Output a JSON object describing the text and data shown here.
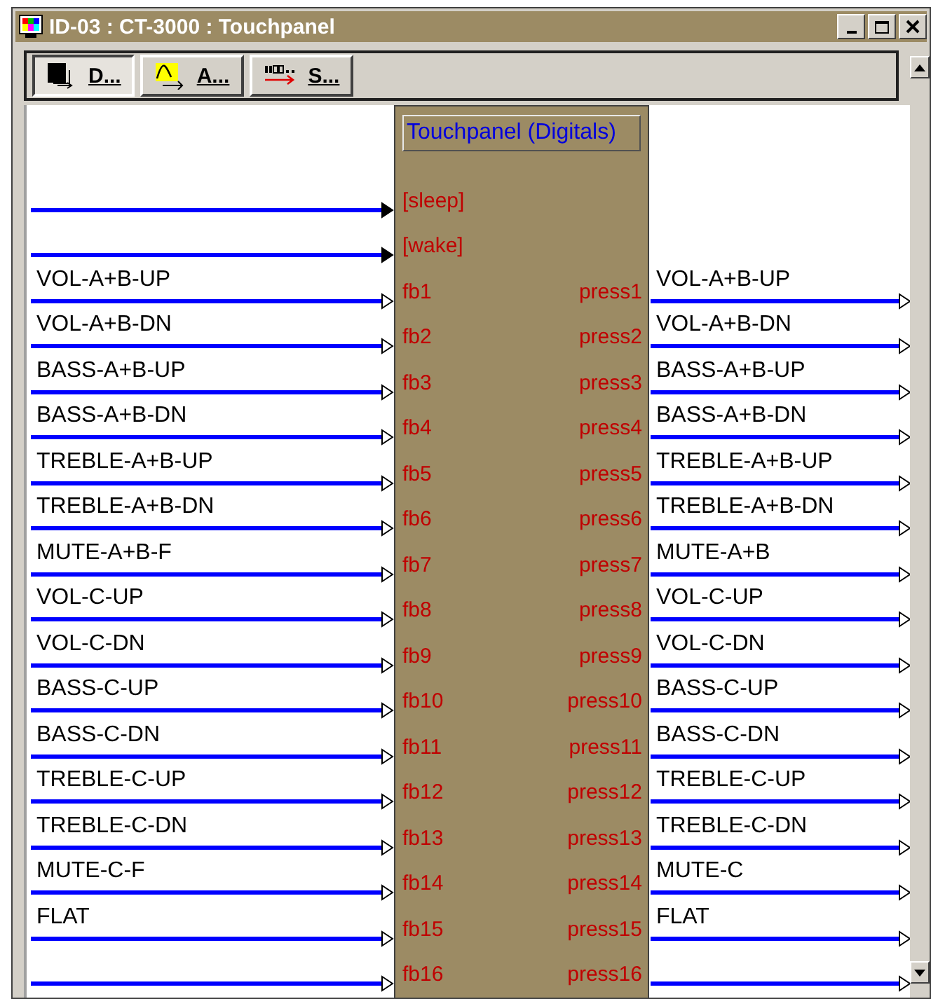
{
  "window": {
    "title": "ID-03 : CT-3000 : Touchpanel"
  },
  "toolbar": {
    "buttons": [
      {
        "label": "D...",
        "kind": "detail",
        "selected": true
      },
      {
        "label": "A...",
        "kind": "analog",
        "selected": false
      },
      {
        "label": "S...",
        "kind": "serial",
        "selected": false
      }
    ]
  },
  "block": {
    "title": "Touchpanel (Digitals)",
    "rows": [
      {
        "kind": "trigger",
        "input_port": "[sleep]"
      },
      {
        "kind": "trigger",
        "input_port": "[wake]"
      },
      {
        "kind": "digital",
        "input_signal": "VOL-A+B-UP",
        "input_port": "fb1",
        "output_port": "press1",
        "output_signal": "VOL-A+B-UP"
      },
      {
        "kind": "digital",
        "input_signal": "VOL-A+B-DN",
        "input_port": "fb2",
        "output_port": "press2",
        "output_signal": "VOL-A+B-DN"
      },
      {
        "kind": "digital",
        "input_signal": "BASS-A+B-UP",
        "input_port": "fb3",
        "output_port": "press3",
        "output_signal": "BASS-A+B-UP"
      },
      {
        "kind": "digital",
        "input_signal": "BASS-A+B-DN",
        "input_port": "fb4",
        "output_port": "press4",
        "output_signal": "BASS-A+B-DN"
      },
      {
        "kind": "digital",
        "input_signal": "TREBLE-A+B-UP",
        "input_port": "fb5",
        "output_port": "press5",
        "output_signal": "TREBLE-A+B-UP"
      },
      {
        "kind": "digital",
        "input_signal": "TREBLE-A+B-DN",
        "input_port": "fb6",
        "output_port": "press6",
        "output_signal": "TREBLE-A+B-DN"
      },
      {
        "kind": "digital",
        "input_signal": "MUTE-A+B-F",
        "input_port": "fb7",
        "output_port": "press7",
        "output_signal": "MUTE-A+B"
      },
      {
        "kind": "digital",
        "input_signal": "VOL-C-UP",
        "input_port": "fb8",
        "output_port": "press8",
        "output_signal": "VOL-C-UP"
      },
      {
        "kind": "digital",
        "input_signal": "VOL-C-DN",
        "input_port": "fb9",
        "output_port": "press9",
        "output_signal": "VOL-C-DN"
      },
      {
        "kind": "digital",
        "input_signal": "BASS-C-UP",
        "input_port": "fb10",
        "output_port": "press10",
        "output_signal": "BASS-C-UP"
      },
      {
        "kind": "digital",
        "input_signal": "BASS-C-DN",
        "input_port": "fb11",
        "output_port": "press11",
        "output_signal": "BASS-C-DN"
      },
      {
        "kind": "digital",
        "input_signal": "TREBLE-C-UP",
        "input_port": "fb12",
        "output_port": "press12",
        "output_signal": "TREBLE-C-UP"
      },
      {
        "kind": "digital",
        "input_signal": "TREBLE-C-DN",
        "input_port": "fb13",
        "output_port": "press13",
        "output_signal": "TREBLE-C-DN"
      },
      {
        "kind": "digital",
        "input_signal": "MUTE-C-F",
        "input_port": "fb14",
        "output_port": "press14",
        "output_signal": "MUTE-C"
      },
      {
        "kind": "digital",
        "input_signal": "FLAT",
        "input_port": "fb15",
        "output_port": "press15",
        "output_signal": "FLAT"
      },
      {
        "kind": "digital",
        "input_port": "fb16",
        "output_port": "press16"
      }
    ]
  }
}
